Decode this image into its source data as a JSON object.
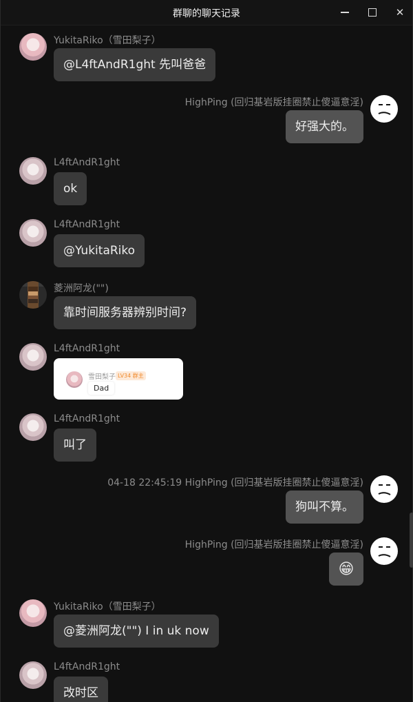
{
  "window": {
    "title": "群聊的聊天记录",
    "min_icon": "minimize-icon",
    "max_icon": "maximize-icon",
    "close_icon": "close-icon",
    "close_glyph": "✕"
  },
  "messages": [
    {
      "name": "YukitaRiko（雪田梨子）",
      "text": "@L4ftAndR1ght 先叫爸爸"
    },
    {
      "name": "HighPing (回归基岩版挂圈禁止傻逼意淫)",
      "text": "好强大的。"
    },
    {
      "name": "L4ftAndR1ght",
      "text": "ok"
    },
    {
      "name": "L4ftAndR1ght",
      "text": "@YukitaRiko"
    },
    {
      "name": "菱洲阿龙(\"\")",
      "text": "靠时间服务器辨别时间?"
    },
    {
      "name": "L4ftAndR1ght",
      "card": {
        "name": "雪田梨子",
        "level": "LV34 群主",
        "text": "Dad"
      }
    },
    {
      "name": "L4ftAndR1ght",
      "text": "叫了"
    },
    {
      "name": "04-18 22:45:19 HighPing (回归基岩版挂圈禁止傻逼意淫)",
      "text": "狗叫不算。"
    },
    {
      "name": "HighPing (回归基岩版挂圈禁止傻逼意淫)",
      "emoji": "😁"
    },
    {
      "name": "YukitaRiko（雪田梨子）",
      "text": "@菱洲阿龙(\"\") I in uk now"
    },
    {
      "name": "L4ftAndR1ght",
      "text": "改时区"
    }
  ],
  "colors": {
    "background": "#111111",
    "other_bubble": "#3a3a3a",
    "self_bubble": "#535353",
    "name_text": "#8c8c8c"
  }
}
